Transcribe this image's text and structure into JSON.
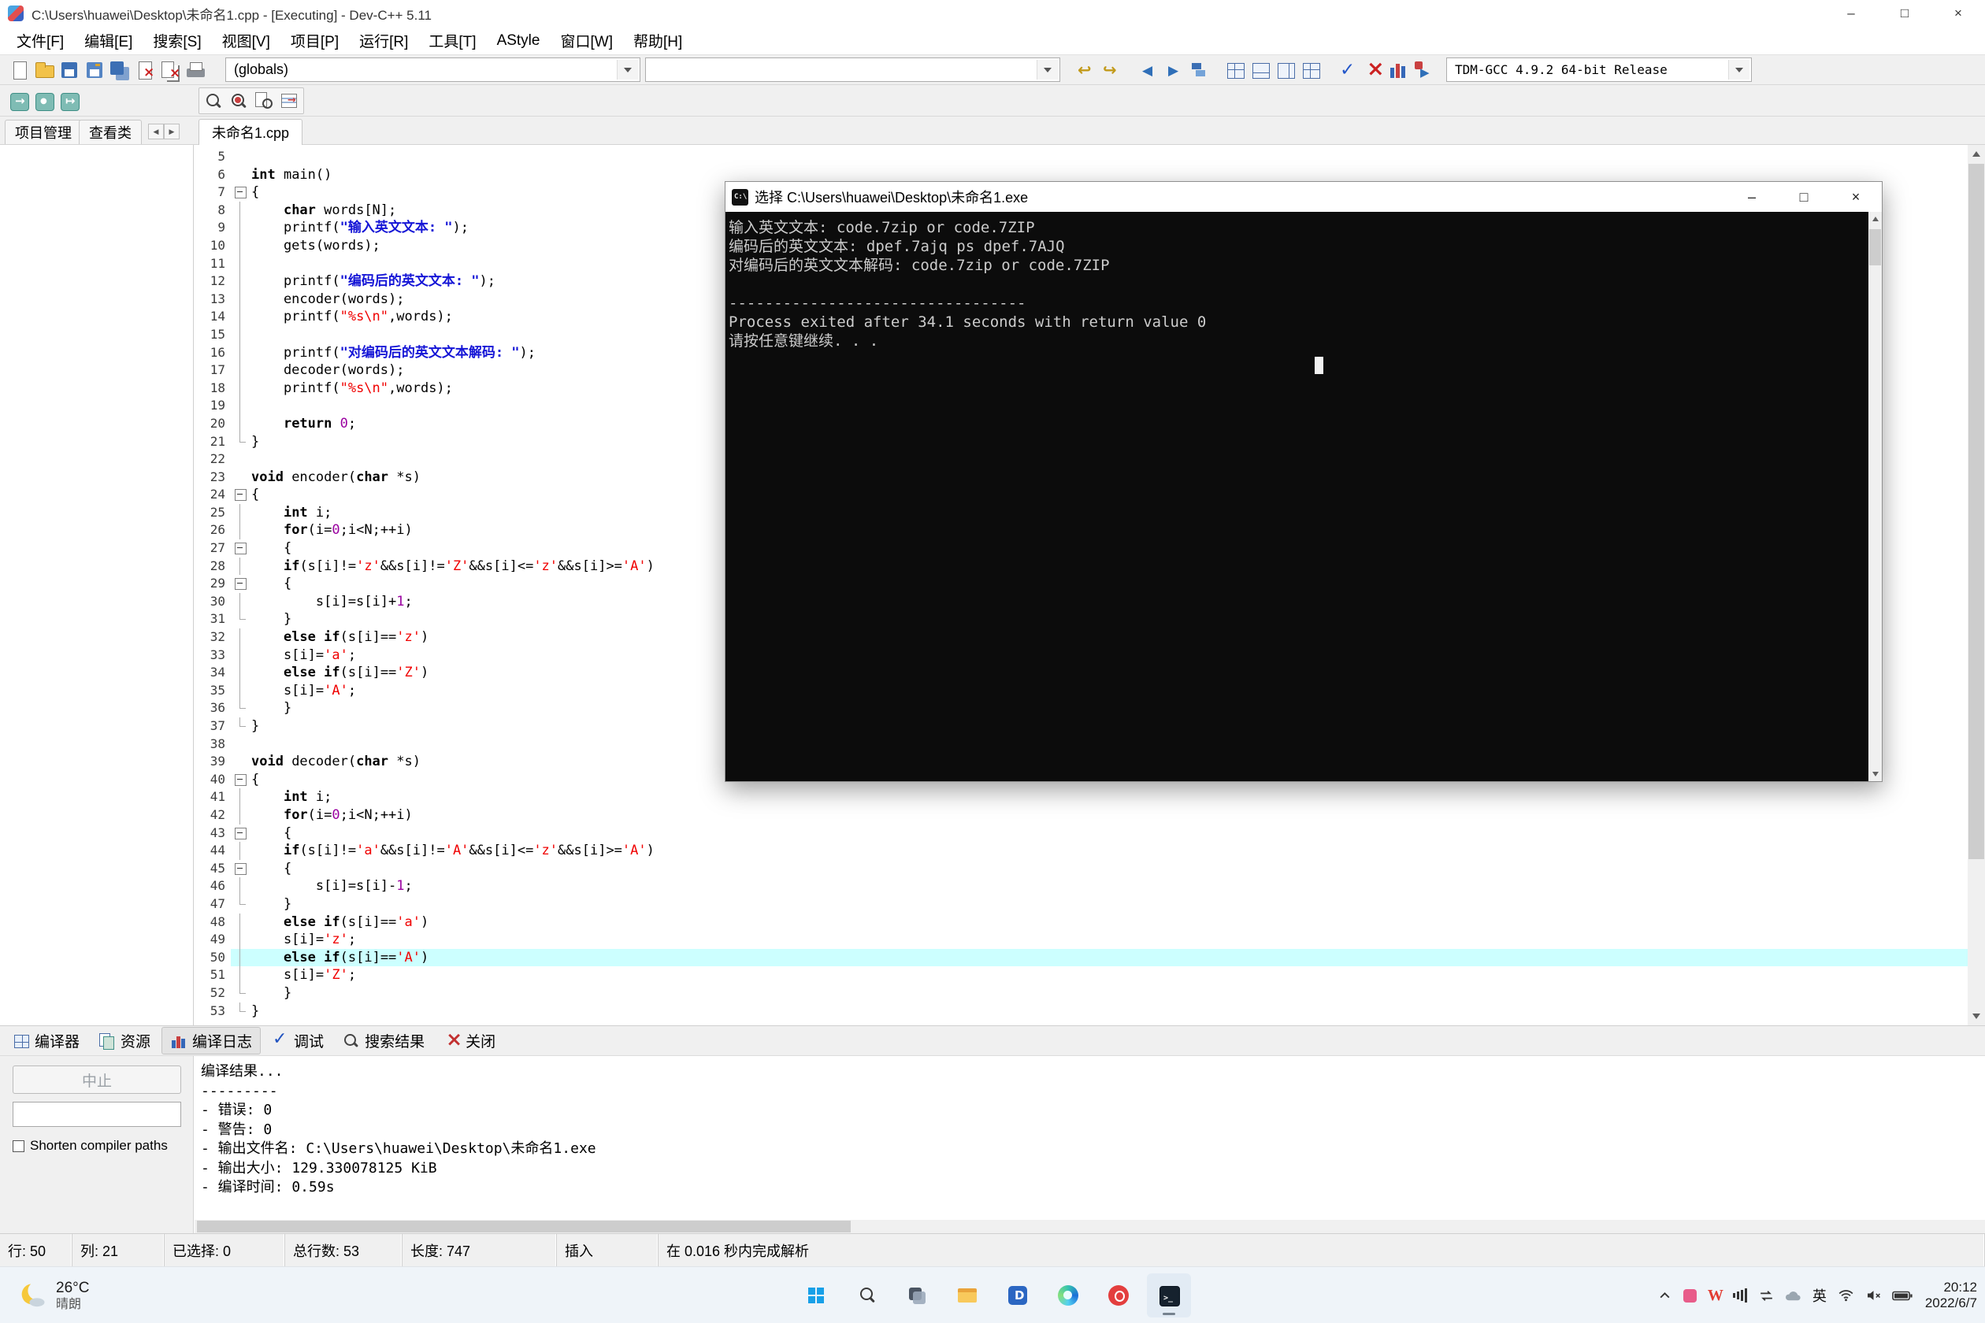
{
  "window": {
    "title": "C:\\Users\\huawei\\Desktop\\未命名1.cpp - [Executing] - Dev-C++ 5.11",
    "controls": {
      "minimize": "–",
      "maximize": "□",
      "close": "×"
    }
  },
  "menu": {
    "items": [
      "文件[F]",
      "编辑[E]",
      "搜索[S]",
      "视图[V]",
      "项目[P]",
      "运行[R]",
      "工具[T]",
      "AStyle",
      "窗口[W]",
      "帮助[H]"
    ]
  },
  "toolbars": {
    "file_icons": [
      "new-file",
      "open",
      "save",
      "save-as",
      "save-all",
      "close",
      "close-all",
      "print"
    ],
    "globals_combo": "(globals)",
    "search_combo": "",
    "edit_icons": [
      "undo",
      "redo"
    ],
    "nav_icons": [
      "goto-back",
      "goto-forward",
      "flags"
    ],
    "view_icons": [
      "view-project",
      "view-report",
      "view-statusbar",
      "view-toolbars"
    ],
    "run_icons": [
      "compile",
      "rebuild",
      "profile",
      "compile-run"
    ],
    "compiler_combo": "TDM-GCC 4.9.2 64-bit Release",
    "specials_icons": [
      "insert",
      "toggle-bookmark",
      "goto-bookmark"
    ],
    "search_icons": [
      "find",
      "replace",
      "find-in-files",
      "goto-line"
    ]
  },
  "left_panel": {
    "tabs": [
      "项目管理",
      "查看类"
    ]
  },
  "editor": {
    "file_tab": "未命名1.cpp",
    "current_line": 50,
    "lines": [
      {
        "n": 5,
        "f": "",
        "s": []
      },
      {
        "n": 6,
        "f": "",
        "s": [
          [
            "k",
            "int"
          ],
          [
            "t",
            " main()"
          ]
        ]
      },
      {
        "n": 7,
        "f": "s",
        "s": [
          [
            "t",
            "{"
          ]
        ]
      },
      {
        "n": 8,
        "f": "i",
        "s": [
          [
            "t",
            "    "
          ],
          [
            "k",
            "char"
          ],
          [
            "t",
            " words[N];"
          ]
        ]
      },
      {
        "n": 9,
        "f": "i",
        "s": [
          [
            "t",
            "    printf("
          ],
          [
            "c",
            "\"输入英文文本: \""
          ],
          [
            "t",
            ");"
          ]
        ]
      },
      {
        "n": 10,
        "f": "i",
        "s": [
          [
            "t",
            "    gets(words);"
          ]
        ]
      },
      {
        "n": 11,
        "f": "i",
        "s": []
      },
      {
        "n": 12,
        "f": "i",
        "s": [
          [
            "t",
            "    printf("
          ],
          [
            "c",
            "\"编码后的英文文本: \""
          ],
          [
            "t",
            ");"
          ]
        ]
      },
      {
        "n": 13,
        "f": "i",
        "s": [
          [
            "t",
            "    encoder(words);"
          ]
        ]
      },
      {
        "n": 14,
        "f": "i",
        "s": [
          [
            "t",
            "    printf("
          ],
          [
            "s",
            "\"%s\\n\""
          ],
          [
            "t",
            ",words);"
          ]
        ]
      },
      {
        "n": 15,
        "f": "i",
        "s": []
      },
      {
        "n": 16,
        "f": "i",
        "s": [
          [
            "t",
            "    printf("
          ],
          [
            "c",
            "\"对编码后的英文文本解码: \""
          ],
          [
            "t",
            ");"
          ]
        ]
      },
      {
        "n": 17,
        "f": "i",
        "s": [
          [
            "t",
            "    decoder(words);"
          ]
        ]
      },
      {
        "n": 18,
        "f": "i",
        "s": [
          [
            "t",
            "    printf("
          ],
          [
            "s",
            "\"%s\\n\""
          ],
          [
            "t",
            ",words);"
          ]
        ]
      },
      {
        "n": 19,
        "f": "i",
        "s": []
      },
      {
        "n": 20,
        "f": "i",
        "s": [
          [
            "t",
            "    "
          ],
          [
            "k",
            "return"
          ],
          [
            "t",
            " "
          ],
          [
            "n",
            "0"
          ],
          [
            "t",
            ";"
          ]
        ]
      },
      {
        "n": 21,
        "f": "e",
        "s": [
          [
            "t",
            "}"
          ]
        ]
      },
      {
        "n": 22,
        "f": "",
        "s": []
      },
      {
        "n": 23,
        "f": "",
        "s": [
          [
            "k",
            "void"
          ],
          [
            "t",
            " encoder("
          ],
          [
            "k",
            "char"
          ],
          [
            "t",
            " *s)"
          ]
        ]
      },
      {
        "n": 24,
        "f": "s",
        "s": [
          [
            "t",
            "{"
          ]
        ]
      },
      {
        "n": 25,
        "f": "i",
        "s": [
          [
            "t",
            "    "
          ],
          [
            "k",
            "int"
          ],
          [
            "t",
            " i;"
          ]
        ]
      },
      {
        "n": 26,
        "f": "i",
        "s": [
          [
            "t",
            "    "
          ],
          [
            "k",
            "for"
          ],
          [
            "t",
            "(i="
          ],
          [
            "n",
            "0"
          ],
          [
            "t",
            ";i<N;++i)"
          ]
        ]
      },
      {
        "n": 27,
        "f": "s",
        "s": [
          [
            "t",
            "    {"
          ]
        ]
      },
      {
        "n": 28,
        "f": "i",
        "s": [
          [
            "t",
            "    "
          ],
          [
            "k",
            "if"
          ],
          [
            "t",
            "(s[i]!="
          ],
          [
            "s",
            "'z'"
          ],
          [
            "t",
            "&&s[i]!="
          ],
          [
            "s",
            "'Z'"
          ],
          [
            "t",
            "&&s[i]<="
          ],
          [
            "s",
            "'z'"
          ],
          [
            "t",
            "&&s[i]>="
          ],
          [
            "s",
            "'A'"
          ],
          [
            "t",
            ")"
          ]
        ]
      },
      {
        "n": 29,
        "f": "s",
        "s": [
          [
            "t",
            "    {"
          ]
        ]
      },
      {
        "n": 30,
        "f": "i",
        "s": [
          [
            "t",
            "        s[i]=s[i]+"
          ],
          [
            "n",
            "1"
          ],
          [
            "t",
            ";"
          ]
        ]
      },
      {
        "n": 31,
        "f": "e",
        "s": [
          [
            "t",
            "    }"
          ]
        ]
      },
      {
        "n": 32,
        "f": "i",
        "s": [
          [
            "t",
            "    "
          ],
          [
            "k",
            "else"
          ],
          [
            "t",
            " "
          ],
          [
            "k",
            "if"
          ],
          [
            "t",
            "(s[i]=="
          ],
          [
            "s",
            "'z'"
          ],
          [
            "t",
            ")"
          ]
        ]
      },
      {
        "n": 33,
        "f": "i",
        "s": [
          [
            "t",
            "    s[i]="
          ],
          [
            "s",
            "'a'"
          ],
          [
            "t",
            ";"
          ]
        ]
      },
      {
        "n": 34,
        "f": "i",
        "s": [
          [
            "t",
            "    "
          ],
          [
            "k",
            "else"
          ],
          [
            "t",
            " "
          ],
          [
            "k",
            "if"
          ],
          [
            "t",
            "(s[i]=="
          ],
          [
            "s",
            "'Z'"
          ],
          [
            "t",
            ")"
          ]
        ]
      },
      {
        "n": 35,
        "f": "i",
        "s": [
          [
            "t",
            "    s[i]="
          ],
          [
            "s",
            "'A'"
          ],
          [
            "t",
            ";"
          ]
        ]
      },
      {
        "n": 36,
        "f": "e",
        "s": [
          [
            "t",
            "    }"
          ]
        ]
      },
      {
        "n": 37,
        "f": "e",
        "s": [
          [
            "t",
            "}"
          ]
        ]
      },
      {
        "n": 38,
        "f": "",
        "s": []
      },
      {
        "n": 39,
        "f": "",
        "s": [
          [
            "k",
            "void"
          ],
          [
            "t",
            " decoder("
          ],
          [
            "k",
            "char"
          ],
          [
            "t",
            " *s)"
          ]
        ]
      },
      {
        "n": 40,
        "f": "s",
        "s": [
          [
            "t",
            "{"
          ]
        ]
      },
      {
        "n": 41,
        "f": "i",
        "s": [
          [
            "t",
            "    "
          ],
          [
            "k",
            "int"
          ],
          [
            "t",
            " i;"
          ]
        ]
      },
      {
        "n": 42,
        "f": "i",
        "s": [
          [
            "t",
            "    "
          ],
          [
            "k",
            "for"
          ],
          [
            "t",
            "(i="
          ],
          [
            "n",
            "0"
          ],
          [
            "t",
            ";i<N;++i)"
          ]
        ]
      },
      {
        "n": 43,
        "f": "s",
        "s": [
          [
            "t",
            "    {"
          ]
        ]
      },
      {
        "n": 44,
        "f": "i",
        "s": [
          [
            "t",
            "    "
          ],
          [
            "k",
            "if"
          ],
          [
            "t",
            "(s[i]!="
          ],
          [
            "s",
            "'a'"
          ],
          [
            "t",
            "&&s[i]!="
          ],
          [
            "s",
            "'A'"
          ],
          [
            "t",
            "&&s[i]<="
          ],
          [
            "s",
            "'z'"
          ],
          [
            "t",
            "&&s[i]>="
          ],
          [
            "s",
            "'A'"
          ],
          [
            "t",
            ")"
          ]
        ]
      },
      {
        "n": 45,
        "f": "s",
        "s": [
          [
            "t",
            "    {"
          ]
        ]
      },
      {
        "n": 46,
        "f": "i",
        "s": [
          [
            "t",
            "        s[i]=s[i]-"
          ],
          [
            "n",
            "1"
          ],
          [
            "t",
            ";"
          ]
        ]
      },
      {
        "n": 47,
        "f": "e",
        "s": [
          [
            "t",
            "    }"
          ]
        ]
      },
      {
        "n": 48,
        "f": "i",
        "s": [
          [
            "t",
            "    "
          ],
          [
            "k",
            "else"
          ],
          [
            "t",
            " "
          ],
          [
            "k",
            "if"
          ],
          [
            "t",
            "(s[i]=="
          ],
          [
            "s",
            "'a'"
          ],
          [
            "t",
            ")"
          ]
        ]
      },
      {
        "n": 49,
        "f": "i",
        "s": [
          [
            "t",
            "    s[i]="
          ],
          [
            "s",
            "'z'"
          ],
          [
            "t",
            ";"
          ]
        ]
      },
      {
        "n": 50,
        "f": "i",
        "s": [
          [
            "t",
            "    "
          ],
          [
            "k",
            "else"
          ],
          [
            "t",
            " "
          ],
          [
            "k",
            "if"
          ],
          [
            "t",
            "(s[i]=="
          ],
          [
            "s",
            "'A'"
          ],
          [
            "t",
            ")"
          ]
        ]
      },
      {
        "n": 51,
        "f": "i",
        "s": [
          [
            "t",
            "    s[i]="
          ],
          [
            "s",
            "'Z'"
          ],
          [
            "t",
            ";"
          ]
        ]
      },
      {
        "n": 52,
        "f": "e",
        "s": [
          [
            "t",
            "    }"
          ]
        ]
      },
      {
        "n": 53,
        "f": "e",
        "s": [
          [
            "t",
            "}"
          ]
        ]
      }
    ]
  },
  "console_window": {
    "title": "选择 C:\\Users\\huawei\\Desktop\\未命名1.exe",
    "controls": {
      "minimize": "–",
      "maximize": "□",
      "close": "×"
    },
    "lines": [
      "输入英文文本: code.7zip or code.7ZIP",
      "编码后的英文文本: dpef.7ajq ps dpef.7AJQ",
      "对编码后的英文文本解码: code.7zip or code.7ZIP",
      "",
      "---------------------------------",
      "Process exited after 34.1 seconds with return value 0",
      "请按任意键继续. . ."
    ]
  },
  "dock": {
    "tabs": [
      {
        "label": "编译器",
        "icon": "compiler",
        "active": false
      },
      {
        "label": "资源",
        "icon": "resources",
        "active": false
      },
      {
        "label": "编译日志",
        "icon": "compile-log",
        "active": true
      },
      {
        "label": "调试",
        "icon": "debug",
        "active": false
      },
      {
        "label": "搜索结果",
        "icon": "search-results",
        "active": false
      },
      {
        "label": "关闭",
        "icon": "close-panel",
        "active": false
      }
    ],
    "compiler_pane": {
      "abort_label": "中止",
      "shorten_label": "Shorten compiler paths"
    },
    "log_lines": [
      "编译结果...",
      "---------",
      "- 错误: 0",
      "- 警告: 0",
      "- 输出文件名: C:\\Users\\huawei\\Desktop\\未命名1.exe",
      "- 输出大小: 129.330078125 KiB",
      "- 编译时间: 0.59s"
    ]
  },
  "status_bar": {
    "items": [
      "行: 50",
      "列: 21",
      "已选择: 0",
      "总行数: 53",
      "长度: 747",
      "插入",
      "在 0.016 秒内完成解析"
    ]
  },
  "taskbar": {
    "weather": {
      "temp": "26°C",
      "desc": "晴朗"
    },
    "apps": [
      "start",
      "search",
      "task-view",
      "file-explorer",
      "dev-cpp",
      "edge",
      "music",
      "console-app"
    ],
    "active_app": "console-app",
    "tray": {
      "ime": "英",
      "time": "20:12",
      "date": "2022/6/7"
    }
  }
}
